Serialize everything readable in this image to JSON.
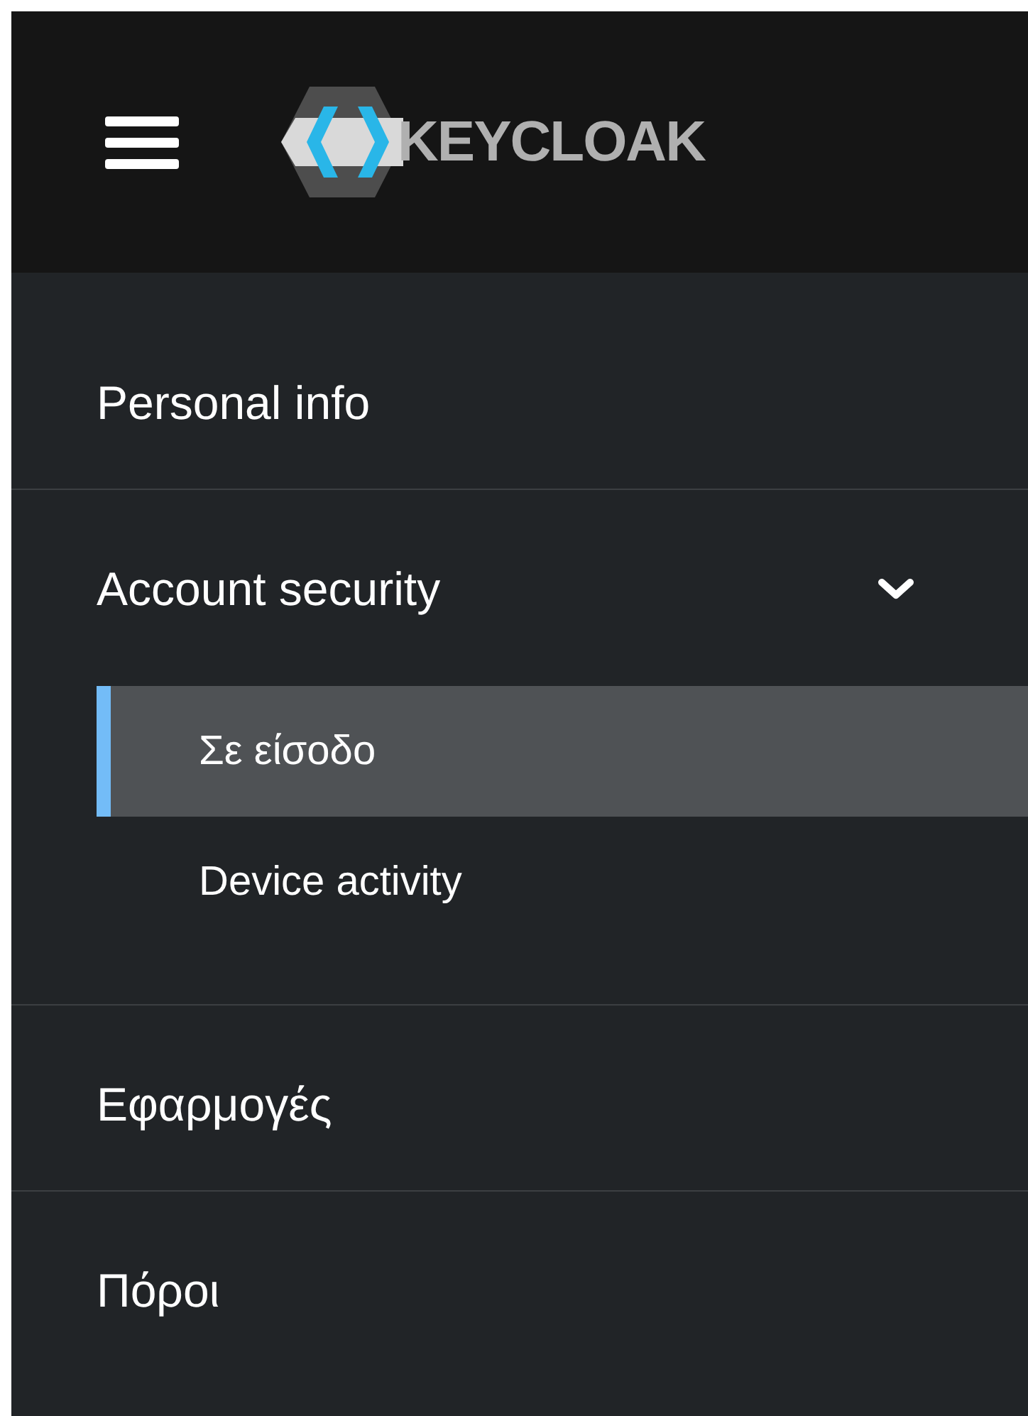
{
  "header": {
    "logo_text": "KEYCLOAK"
  },
  "nav": [
    {
      "kind": "link",
      "label": "Personal info"
    },
    {
      "kind": "group",
      "label": "Account security",
      "expanded": true,
      "children": [
        {
          "label": "Σε είσοδο",
          "selected": true
        },
        {
          "label": "Device activity",
          "selected": false
        }
      ]
    },
    {
      "kind": "link",
      "label": "Εφαρμογές"
    },
    {
      "kind": "link",
      "label": "Πόροι"
    }
  ]
}
